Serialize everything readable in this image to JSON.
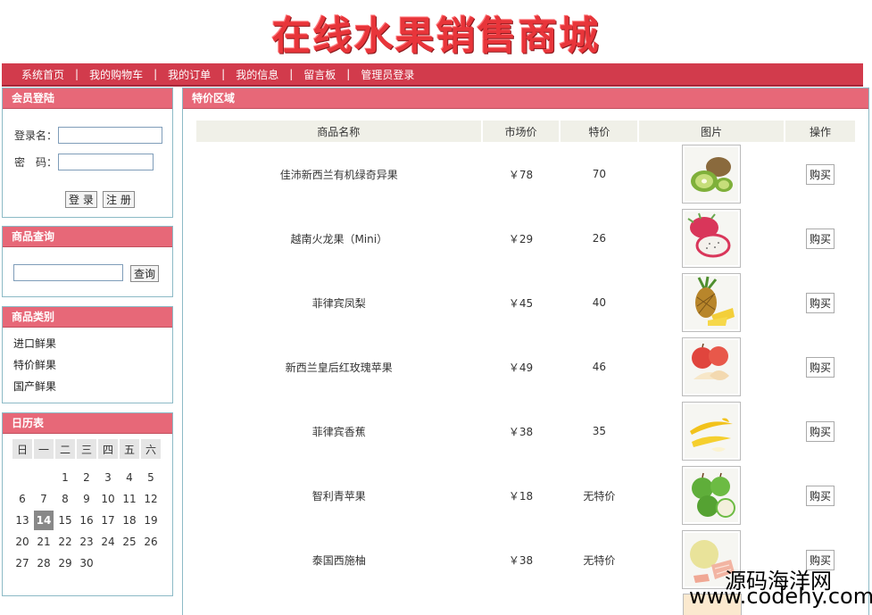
{
  "site": {
    "title": "在线水果销售商城"
  },
  "nav": {
    "items": [
      "系统首页",
      "我的购物车",
      "我的订单",
      "我的信息",
      "留言板",
      "管理员登录"
    ],
    "separator": "|"
  },
  "login": {
    "title": "会员登陆",
    "username_label": "登录名：",
    "password_label": "密　码：",
    "username_value": "",
    "password_value": "",
    "login_button": "登 录",
    "register_button": "注 册"
  },
  "search": {
    "title": "商品查询",
    "input_value": "",
    "button": "查询"
  },
  "categories": {
    "title": "商品类别",
    "items": [
      "进口鲜果",
      "特价鲜果",
      "国产鲜果"
    ]
  },
  "calendar": {
    "title": "日历表",
    "weekdays": [
      "日",
      "一",
      "二",
      "三",
      "四",
      "五",
      "六"
    ],
    "weeks": [
      [
        "",
        "",
        "1",
        "2",
        "3",
        "4",
        "5"
      ],
      [
        "6",
        "7",
        "8",
        "9",
        "10",
        "11",
        "12"
      ],
      [
        "13",
        "14",
        "15",
        "16",
        "17",
        "18",
        "19"
      ],
      [
        "20",
        "21",
        "22",
        "23",
        "24",
        "25",
        "26"
      ],
      [
        "27",
        "28",
        "29",
        "30",
        "",
        "",
        ""
      ]
    ],
    "today": "14"
  },
  "special": {
    "title": "特价区域",
    "columns": [
      "商品名称",
      "市场价",
      "特价",
      "图片",
      "操作"
    ],
    "rows": [
      {
        "name": "佳沛新西兰有机绿奇异果",
        "market": "￥78",
        "special": "70",
        "image": "kiwi",
        "action": "购买"
      },
      {
        "name": "越南火龙果（Mini）",
        "market": "￥29",
        "special": "26",
        "image": "dragonfruit",
        "action": "购买"
      },
      {
        "name": "菲律宾凤梨",
        "market": "￥45",
        "special": "40",
        "image": "pineapple",
        "action": "购买"
      },
      {
        "name": "新西兰皇后红玫瑰苹果",
        "market": "￥49",
        "special": "46",
        "image": "red-apple",
        "action": "购买"
      },
      {
        "name": "菲律宾香蕉",
        "market": "￥38",
        "special": "35",
        "image": "banana",
        "action": "购买"
      },
      {
        "name": "智利青苹果",
        "market": "￥18",
        "special": "无特价",
        "image": "green-apple",
        "action": "购买"
      },
      {
        "name": "泰国西施柚",
        "market": "￥38",
        "special": "无特价",
        "image": "pomelo",
        "action": "购买"
      }
    ]
  },
  "watermark": {
    "line1": "源码海洋网",
    "line2": "www.codehy.com"
  }
}
